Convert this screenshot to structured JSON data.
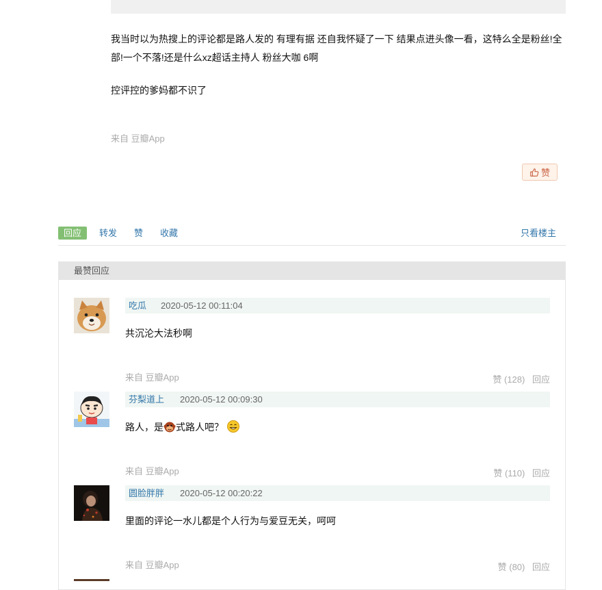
{
  "post": {
    "paragraphs": [
      "我当时以为热搜上的评论都是路人发的 有理有据 还自我怀疑了一下 结果点进头像一看，这特么全是粉丝!全部!一个不落!还是什么xz超话主持人 粉丝大咖  6啊",
      "控评控的爹妈都不识了"
    ],
    "source": "来自 豆瓣App",
    "like_label": "赞",
    "like_icon": "thumbs-up-icon"
  },
  "actions": {
    "reply": "回应",
    "forward": "转发",
    "like": "赞",
    "collect": "收藏",
    "only_op": "只看楼主"
  },
  "best": {
    "title": "最赞回应",
    "comments": [
      {
        "user": "吃瓜",
        "time": "2020-05-12 00:11:04",
        "text": "共沉沦大法秒啊",
        "source": "来自 豆瓣App",
        "likes": "赞 (128)",
        "reply": "回应",
        "avatar": "shiba-dog-avatar"
      },
      {
        "user": "芬梨道上",
        "time": "2020-05-12 00:09:30",
        "text_before": "路人，是",
        "text_after": "式路人吧？",
        "source": "来自 豆瓣App",
        "likes": "赞 (110)",
        "reply": "回应",
        "avatar": "cartoon-boy-avatar"
      },
      {
        "user": "圆脸胖胖",
        "time": "2020-05-12 00:20:22",
        "text": "里面的评论一水儿都是个人行为与爱豆无关，呵呵",
        "source": "来自 豆瓣App",
        "likes": "赞 (80)",
        "reply": "回应",
        "avatar": "dark-portrait-avatar"
      }
    ]
  },
  "colors": {
    "link": "#3377aa",
    "reply_badge": "#83bf73",
    "like_text": "#ca6445",
    "meta_bg": "#f0f6f3",
    "muted": "#aaaaaa"
  }
}
